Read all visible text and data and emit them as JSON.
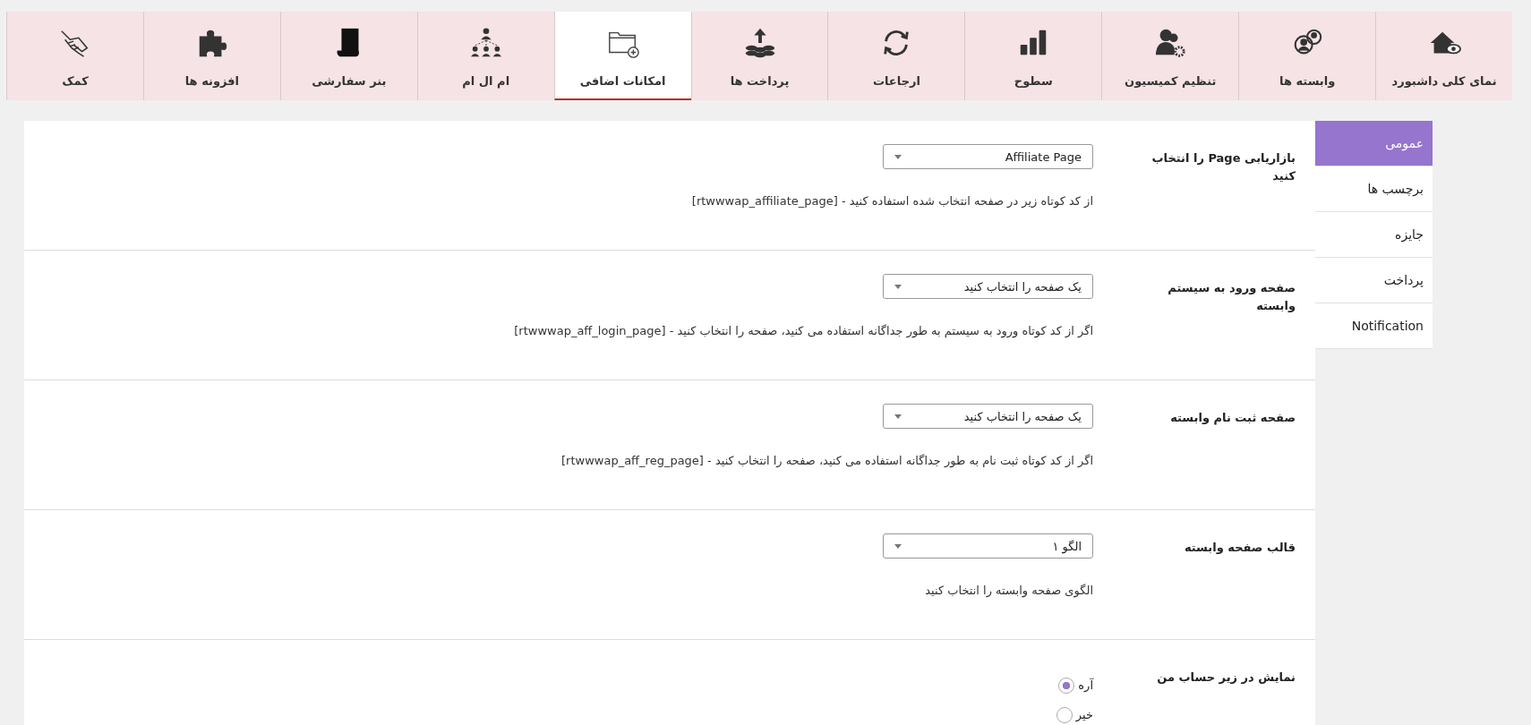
{
  "tabs": [
    {
      "label": "نمای کلی داشبورد",
      "kind": "house",
      "selected": false
    },
    {
      "label": "وابسته ها",
      "kind": "users",
      "selected": false
    },
    {
      "label": "تنظیم کمیسیون",
      "kind": "user-gear",
      "selected": false
    },
    {
      "label": "سطوح",
      "kind": "bars",
      "selected": false
    },
    {
      "label": "ارجاعات",
      "kind": "refresh",
      "selected": false
    },
    {
      "label": "پرداخت ها",
      "kind": "coins",
      "selected": false
    },
    {
      "label": "امکانات اضافی",
      "kind": "folder",
      "selected": true
    },
    {
      "label": "ام ال ام",
      "kind": "hierarchy",
      "selected": false
    },
    {
      "label": "بنر سفارشی",
      "kind": "page",
      "selected": false
    },
    {
      "label": "افزونه ها",
      "kind": "puzzle",
      "selected": false
    },
    {
      "label": "کمک",
      "kind": "hand",
      "selected": false
    }
  ],
  "sidebar": {
    "items": [
      {
        "label": "عمومی",
        "selected": true
      },
      {
        "label": "برچسب ها",
        "selected": false
      },
      {
        "label": "جایزه",
        "selected": false
      },
      {
        "label": "پرداخت",
        "selected": false
      },
      {
        "label": "Notification",
        "selected": false
      }
    ]
  },
  "settings": [
    {
      "kind": "select",
      "label": "بازاریابی Page را انتخاب کنید",
      "value": "Affiliate Page",
      "description": "از کد کوتاه زیر در صفحه انتخاب شده استفاده کنید - [rtwwwap_affiliate_page]"
    },
    {
      "kind": "select",
      "label": "صفحه ورود به سیستم وابسته",
      "value": "یک صفحه را انتخاب کنید",
      "description": "اگر از کد کوتاه ورود به سیستم به طور جداگانه استفاده می کنید، صفحه را انتخاب کنید - [rtwwwap_aff_login_page]"
    },
    {
      "kind": "select",
      "label": "صفحه ثبت نام وابسته",
      "value": "یک صفحه را انتخاب کنید",
      "description": "اگر از کد کوتاه ثبت نام به طور جداگانه استفاده می کنید، صفحه را انتخاب کنید - [rtwwwap_aff_reg_page]"
    },
    {
      "kind": "select",
      "label": "قالب صفحه وابسته",
      "value": "الگو ۱",
      "description": "الگوی صفحه وابسته را انتخاب کنید"
    },
    {
      "kind": "radio",
      "label": "نمایش در زیر حساب من",
      "options": [
        {
          "label": "آره",
          "selected": true
        },
        {
          "label": "خیر",
          "selected": false
        }
      ]
    }
  ]
}
